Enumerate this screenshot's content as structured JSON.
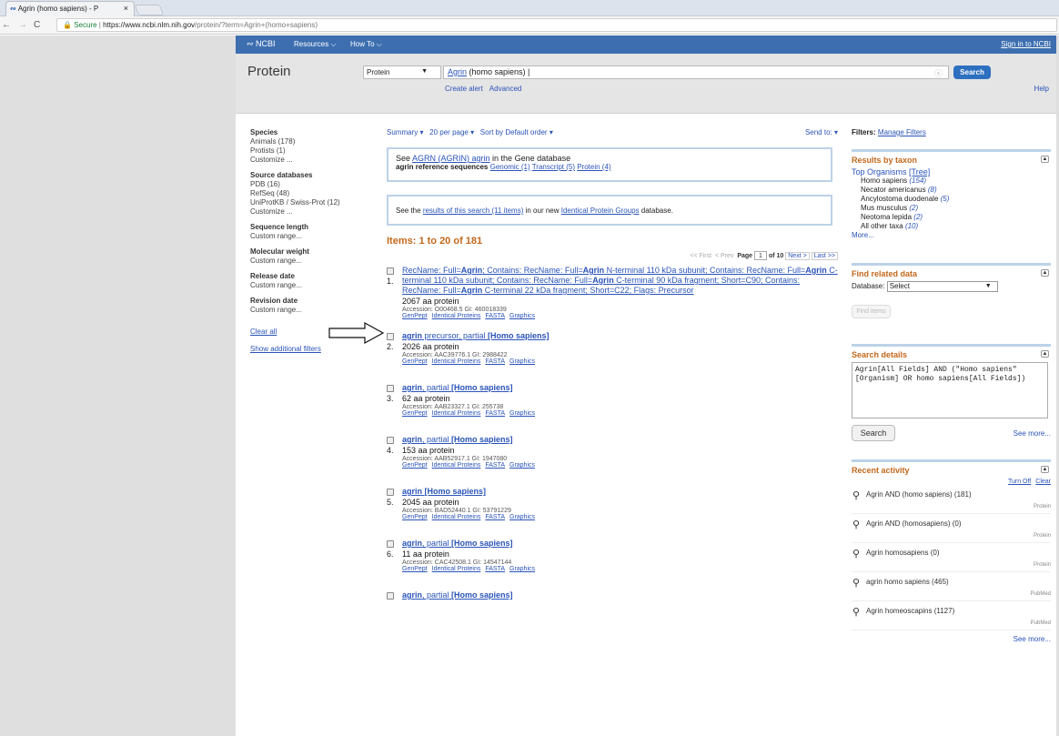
{
  "browser": {
    "tab_title": "Agrin (homo sapiens) - P",
    "url_secure": "Secure",
    "url_host": "https://www.ncbi.nlm.nih.gov",
    "url_path": "/protein/?term=Agrin+(homo+sapiens)"
  },
  "ncbi": {
    "logo": "NCBI",
    "resources": "Resources",
    "howto": "How To",
    "signin": "Sign in to NCBI"
  },
  "search": {
    "db_title": "Protein",
    "db_select": "Protein",
    "term_bold": "Agrin",
    "term_rest": " (homo sapiens)",
    "button": "Search",
    "create_alert": "Create alert",
    "advanced": "Advanced",
    "help": "Help"
  },
  "left": {
    "species_h": "Species",
    "animals": "Animals (178)",
    "protists": "Protists (1)",
    "customize1": "Customize ...",
    "source_h": "Source databases",
    "pdb": "PDB (16)",
    "refseq": "RefSeq (48)",
    "uniprot": "UniProtKB / Swiss-Prot (12)",
    "customize2": "Customize ...",
    "seqlen_h": "Sequence length",
    "seqlen_v": "Custom range...",
    "molw_h": "Molecular weight",
    "molw_v": "Custom range...",
    "rel_h": "Release date",
    "rel_v": "Custom range...",
    "rev_h": "Revision date",
    "rev_v": "Custom range...",
    "clear": "Clear all",
    "show": "Show additional filters"
  },
  "center": {
    "summary": "Summary",
    "perpage": "20 per page",
    "sort": "Sort by Default order",
    "sendto": "Send to:",
    "box1_pre": "See ",
    "box1_link": "AGRN (AGRIN) agrin",
    "box1_post": " in the Gene database",
    "box1_l2": "agrin reference sequences",
    "genomic": "Genomic (1)",
    "transcript": "Transcript (5)",
    "protein": "Protein (4)",
    "box2_pre": "See the ",
    "box2_link": "results of this search (11 items)",
    "box2_mid": " in our new ",
    "box2_link2": "Identical Protein Groups",
    "box2_post": " database.",
    "items": "Items: 1 to 20 of 181",
    "first": "<< First",
    "prev": "< Prev",
    "page": "Page",
    "page_num": "1",
    "of": "of 10",
    "next": "Next >",
    "last": "Last >>",
    "l_genpept": "GenPept",
    "l_ident": "Identical Proteins",
    "l_fasta": "FASTA",
    "l_graphics": "Graphics",
    "results": [
      {
        "num": "1.",
        "size": "2067 aa protein",
        "acc": "Accession: O00468.5   GI: 460018339"
      },
      {
        "num": "2.",
        "size": "2026 aa protein",
        "acc": "Accession: AAC39776.1   GI: 2988422"
      },
      {
        "num": "3.",
        "size": "62 aa protein",
        "acc": "Accession: AAB23327.1   GI: 255738"
      },
      {
        "num": "4.",
        "size": "153 aa protein",
        "acc": "Accession: AAB52917.1   GI: 1947080"
      },
      {
        "num": "5.",
        "size": "2045 aa protein",
        "acc": "Accession: BAD52440.1   GI: 53791229"
      },
      {
        "num": "6.",
        "size": "11 aa protein",
        "acc": "Accession: CAC42508.1   GI: 14547144"
      }
    ]
  },
  "right": {
    "filters": "Filters:",
    "manage": "Manage Filters",
    "taxon_h": "Results by taxon",
    "top_org": "Top Organisms",
    "tree": "[Tree]",
    "taxa": [
      {
        "n": "Homo sapiens",
        "c": "(154)"
      },
      {
        "n": "Necator americanus",
        "c": "(8)"
      },
      {
        "n": "Ancylostoma duodenale",
        "c": "(5)"
      },
      {
        "n": "Mus musculus",
        "c": "(2)"
      },
      {
        "n": "Neotoma lepida",
        "c": "(2)"
      },
      {
        "n": "All other taxa",
        "c": "(10)"
      }
    ],
    "more": "More...",
    "related_h": "Find related data",
    "database": "Database:",
    "select": "Select",
    "find": "Find items",
    "details_h": "Search details",
    "details": "Agrin[All Fields] AND (\"Homo sapiens\"[Organism] OR homo sapiens[All Fields])",
    "search_btn": "Search",
    "see_more": "See more...",
    "recent_h": "Recent activity",
    "turnoff": "Turn Off",
    "clear": "Clear",
    "activity": [
      {
        "t": "Agrin AND (homo sapiens) (181)",
        "d": "Protein"
      },
      {
        "t": "Agrin AND (homosapiens) (0)",
        "d": "Protein"
      },
      {
        "t": "Agrin homosapiens (0)",
        "d": "Protein"
      },
      {
        "t": "agrin homo sapiens (465)",
        "d": "PubMed"
      },
      {
        "t": "Agrin homeoscapins (1127)",
        "d": "PubMed"
      }
    ],
    "see_more2": "See more..."
  }
}
